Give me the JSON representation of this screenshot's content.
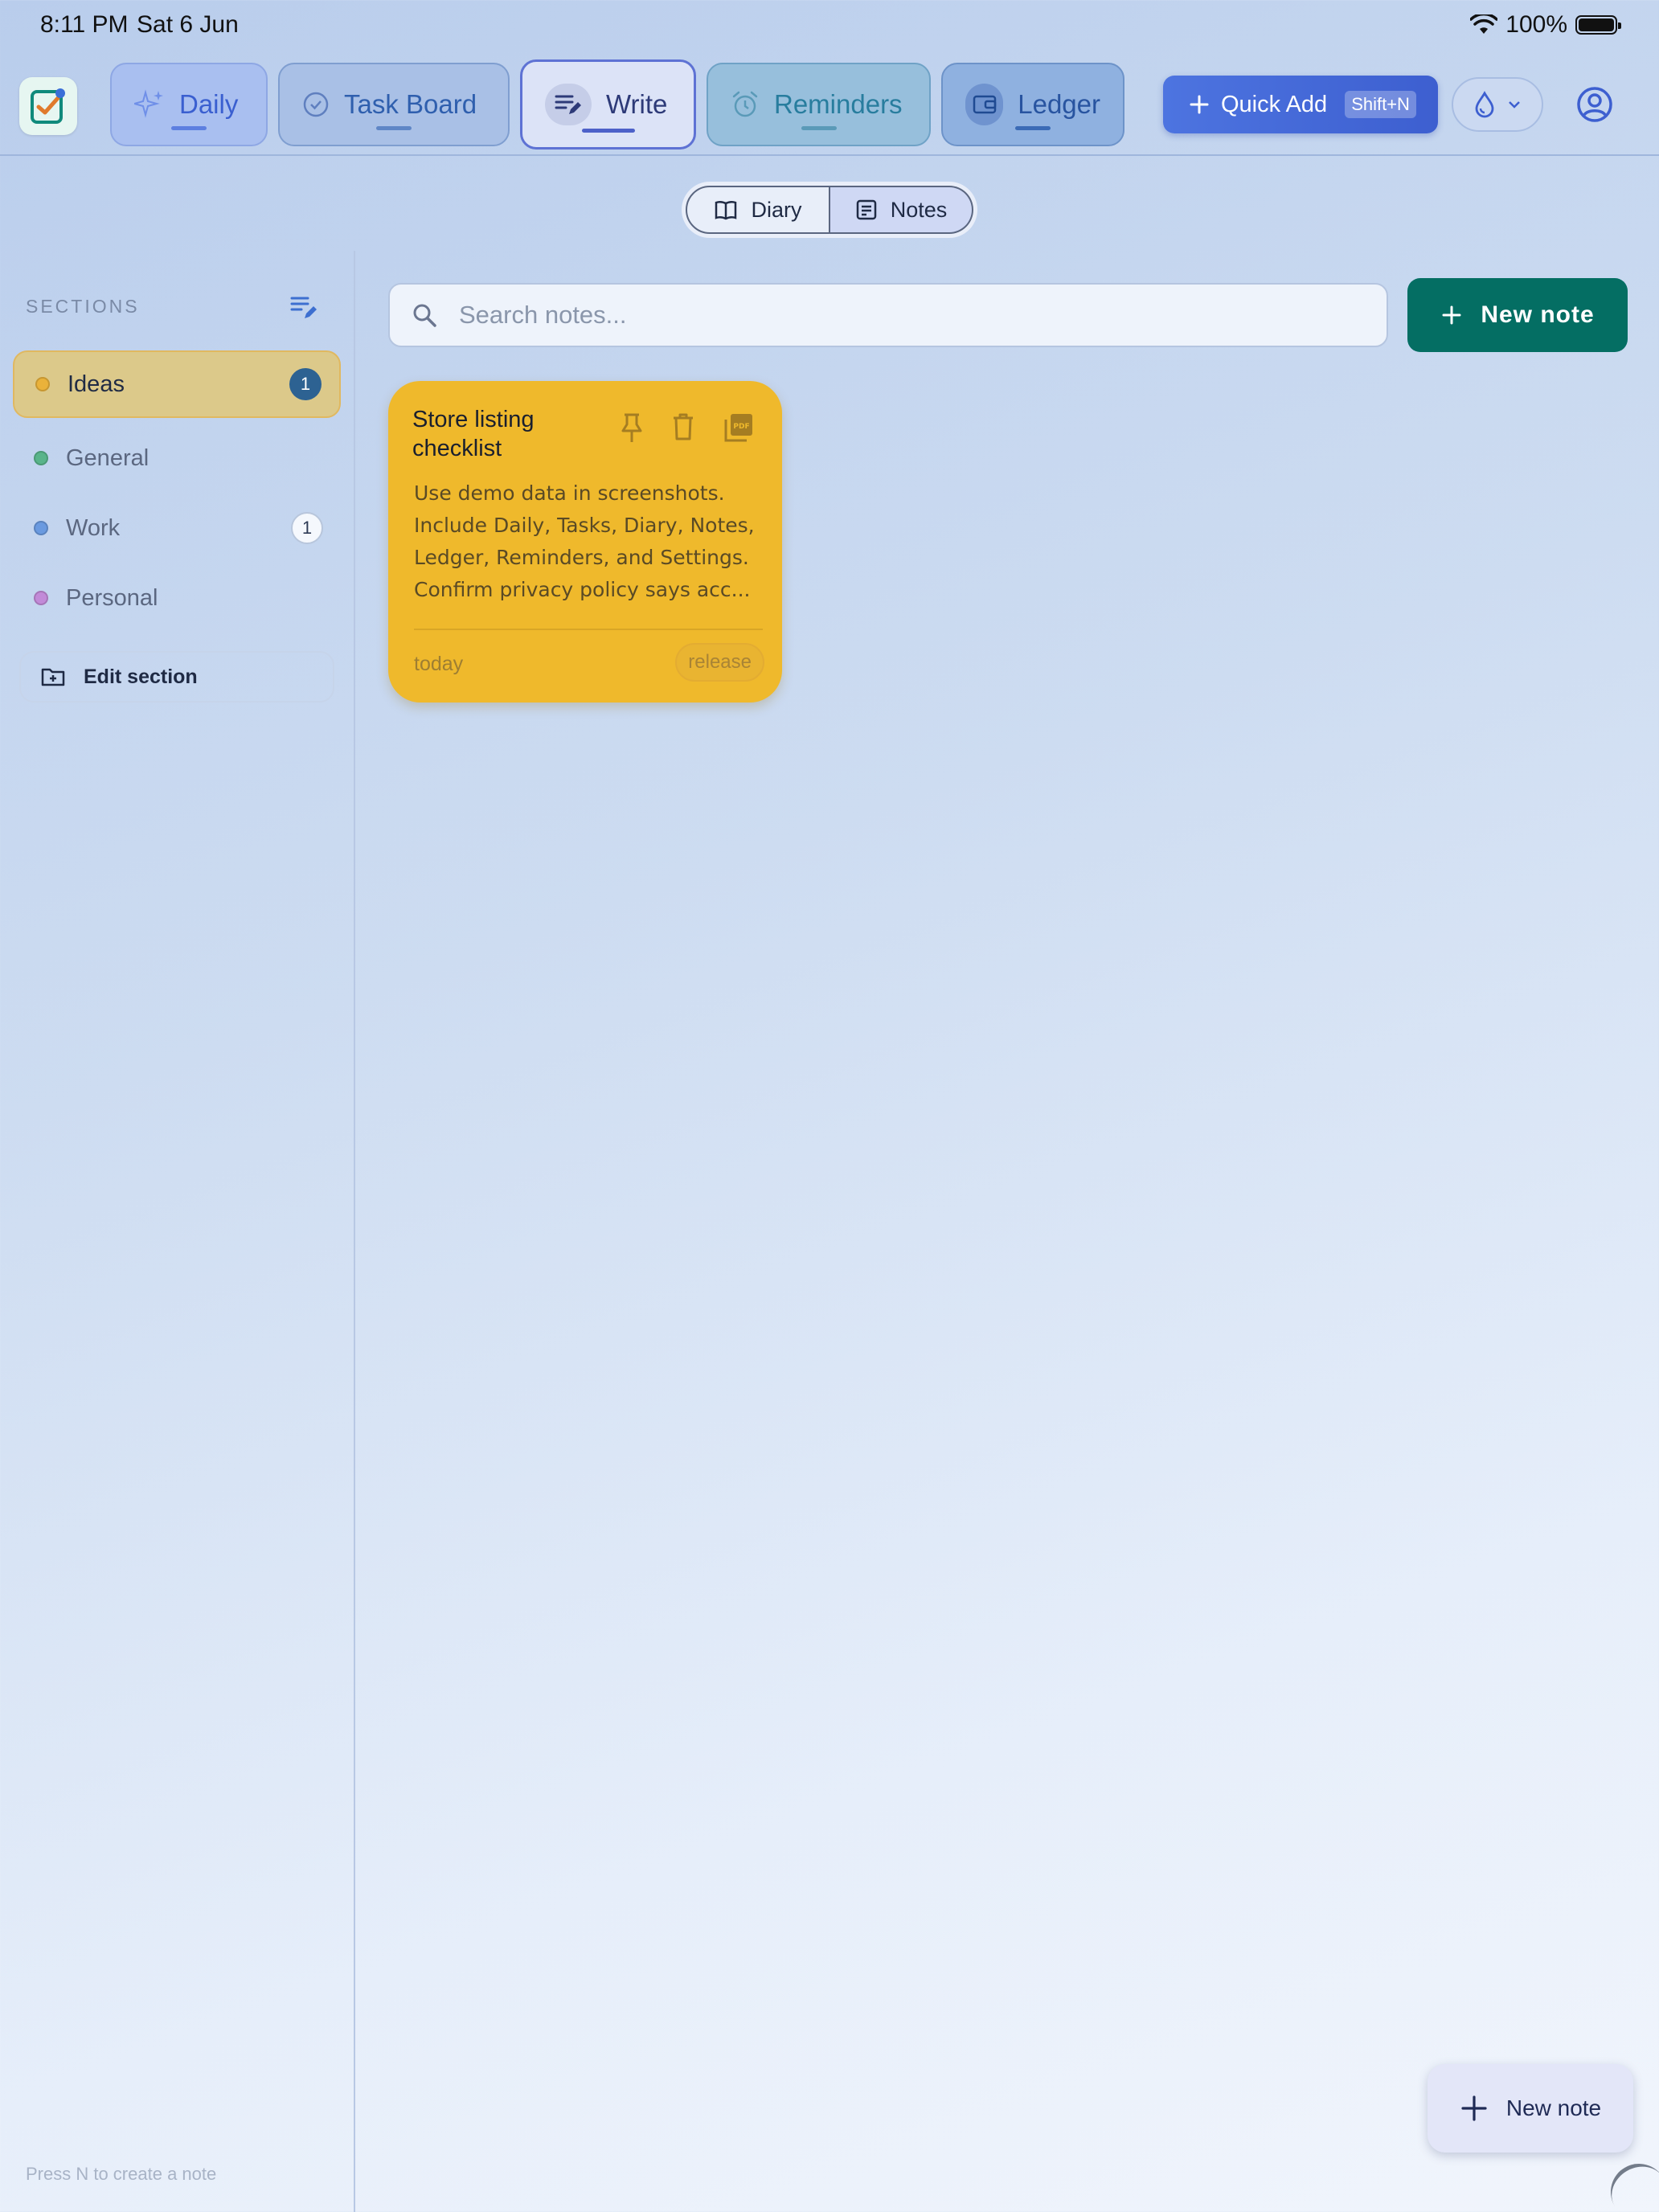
{
  "status_bar": {
    "time": "8:11 PM",
    "date": "Sat 6 Jun",
    "battery": "100%"
  },
  "nav": {
    "tabs": [
      {
        "label": "Daily"
      },
      {
        "label": "Task Board"
      },
      {
        "label": "Write"
      },
      {
        "label": "Reminders"
      },
      {
        "label": "Ledger"
      }
    ],
    "active_tab": "Write",
    "quick_add": {
      "label": "Quick Add",
      "shortcut": "Shift+N"
    }
  },
  "write_mode": {
    "options": [
      "Diary",
      "Notes"
    ],
    "selected": "Notes"
  },
  "sidebar": {
    "title": "SECTIONS",
    "sections": [
      {
        "label": "Ideas",
        "color": "#eab23a",
        "count": "1",
        "active": true
      },
      {
        "label": "General",
        "color": "#59b48a",
        "count": "",
        "active": false
      },
      {
        "label": "Work",
        "color": "#6a9ae0",
        "count": "1",
        "active": false
      },
      {
        "label": "Personal",
        "color": "#c28ad8",
        "count": "",
        "active": false
      }
    ],
    "edit_section_label": "Edit section",
    "hint": "Press N to create a note"
  },
  "search": {
    "placeholder": "Search notes...",
    "value": ""
  },
  "new_note_label": "New note",
  "notes": [
    {
      "title": "Store listing checklist",
      "body": "Use demo data in screenshots. Include Daily, Tasks, Diary, Notes, Ledger, Reminders, and Settings. Confirm privacy policy says acc...",
      "date": "today",
      "tag": "release",
      "color": "#efb92c"
    }
  ],
  "fab": {
    "label": "New note"
  },
  "colors": {
    "accent": "#4d74e0",
    "primary_action": "#046e63"
  }
}
